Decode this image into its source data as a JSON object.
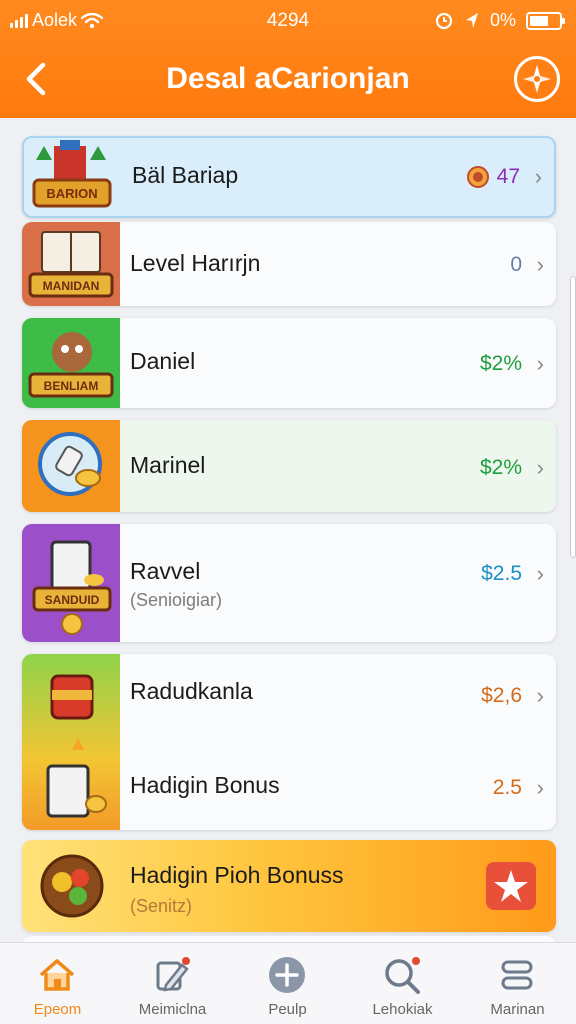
{
  "status_bar": {
    "carrier": "Aolek",
    "time": "4294",
    "battery": "0%",
    "icons": [
      "signal-icon",
      "wifi-icon",
      "alarm-icon",
      "location-icon",
      "battery-icon"
    ]
  },
  "header": {
    "title": "Desal aCarionjan",
    "back_icon": "chevron-left-icon",
    "action_icon": "compass-icon",
    "background": "#ff7f14"
  },
  "items": [
    {
      "label": "Bäl Bariap",
      "badge": "BARION",
      "value": "47",
      "value_icon": "coin-icon",
      "value_color": "#8a2db4",
      "highlight": true
    },
    {
      "label": "Level Harırjn",
      "badge": "MANIDAN",
      "value": "0",
      "value_color": "#6b7fa5"
    },
    {
      "label": "Daniel",
      "badge": "BENLIAM",
      "value": "$2%",
      "value_color": "#1f9e3f"
    },
    {
      "label": "Marinel",
      "value": "$2%",
      "value_color": "#1f9e3f"
    },
    {
      "label": "Ravvel",
      "sublabel": "(Senioigiar)",
      "badge": "SANDUID",
      "value": "$2.5",
      "value_color": "#1a90c8"
    },
    {
      "label": "Radudkanla",
      "value": "$2,6",
      "value_color": "#d36b1a"
    },
    {
      "label": "Hadigin Bonus",
      "value": "2.5",
      "value_color": "#d36b1a"
    },
    {
      "label": "Hadigin Pioh Bonuss",
      "sublabel": "(Senitz)",
      "action_icon": "star-badge-icon"
    }
  ],
  "tabs": [
    {
      "label": "Epeom",
      "icon": "home-icon",
      "active": true
    },
    {
      "label": "Meimiclna",
      "icon": "edit-icon"
    },
    {
      "label": "Peulp",
      "icon": "add-icon"
    },
    {
      "label": "Lehokiak",
      "icon": "search-icon"
    },
    {
      "label": "Marinan",
      "icon": "menu-icon"
    }
  ],
  "colors": {
    "accent": "#ff7f14",
    "active_tab": "#f08a1a"
  }
}
